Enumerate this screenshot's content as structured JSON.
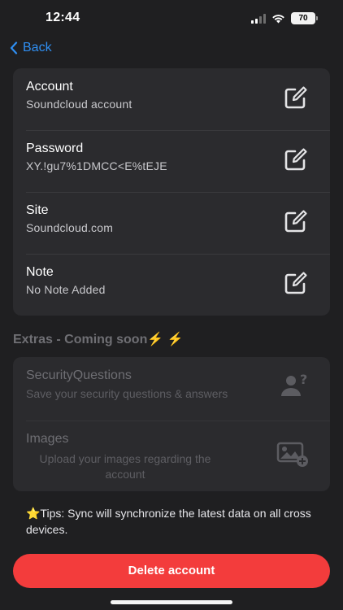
{
  "status_bar": {
    "time": "12:44",
    "battery": "70"
  },
  "nav": {
    "back_label": "Back"
  },
  "fields": [
    {
      "title": "Account",
      "value": "Soundcloud account"
    },
    {
      "title": "Password",
      "value": "XY.!gu7%1DMCC<E%tEJE"
    },
    {
      "title": "Site",
      "value": "Soundcloud.com"
    },
    {
      "title": "Note",
      "value": "No Note Added"
    }
  ],
  "extras": {
    "title": "Extras - Coming soon⚡️ ⚡️",
    "items": [
      {
        "title": "SecurityQuestions",
        "subtitle": "Save your security questions & answers",
        "icon": "person-question-icon"
      },
      {
        "title": "Images",
        "subtitle": "Upload your images regarding the account",
        "icon": "image-add-icon"
      }
    ]
  },
  "tips": "⭐️Tips: Sync will synchronize the latest data on all cross devices.",
  "delete_label": "Delete account",
  "colors": {
    "accent": "#2f8ff3",
    "danger": "#f33c3c",
    "background": "#1f1f21",
    "card": "#2b2b2e"
  }
}
